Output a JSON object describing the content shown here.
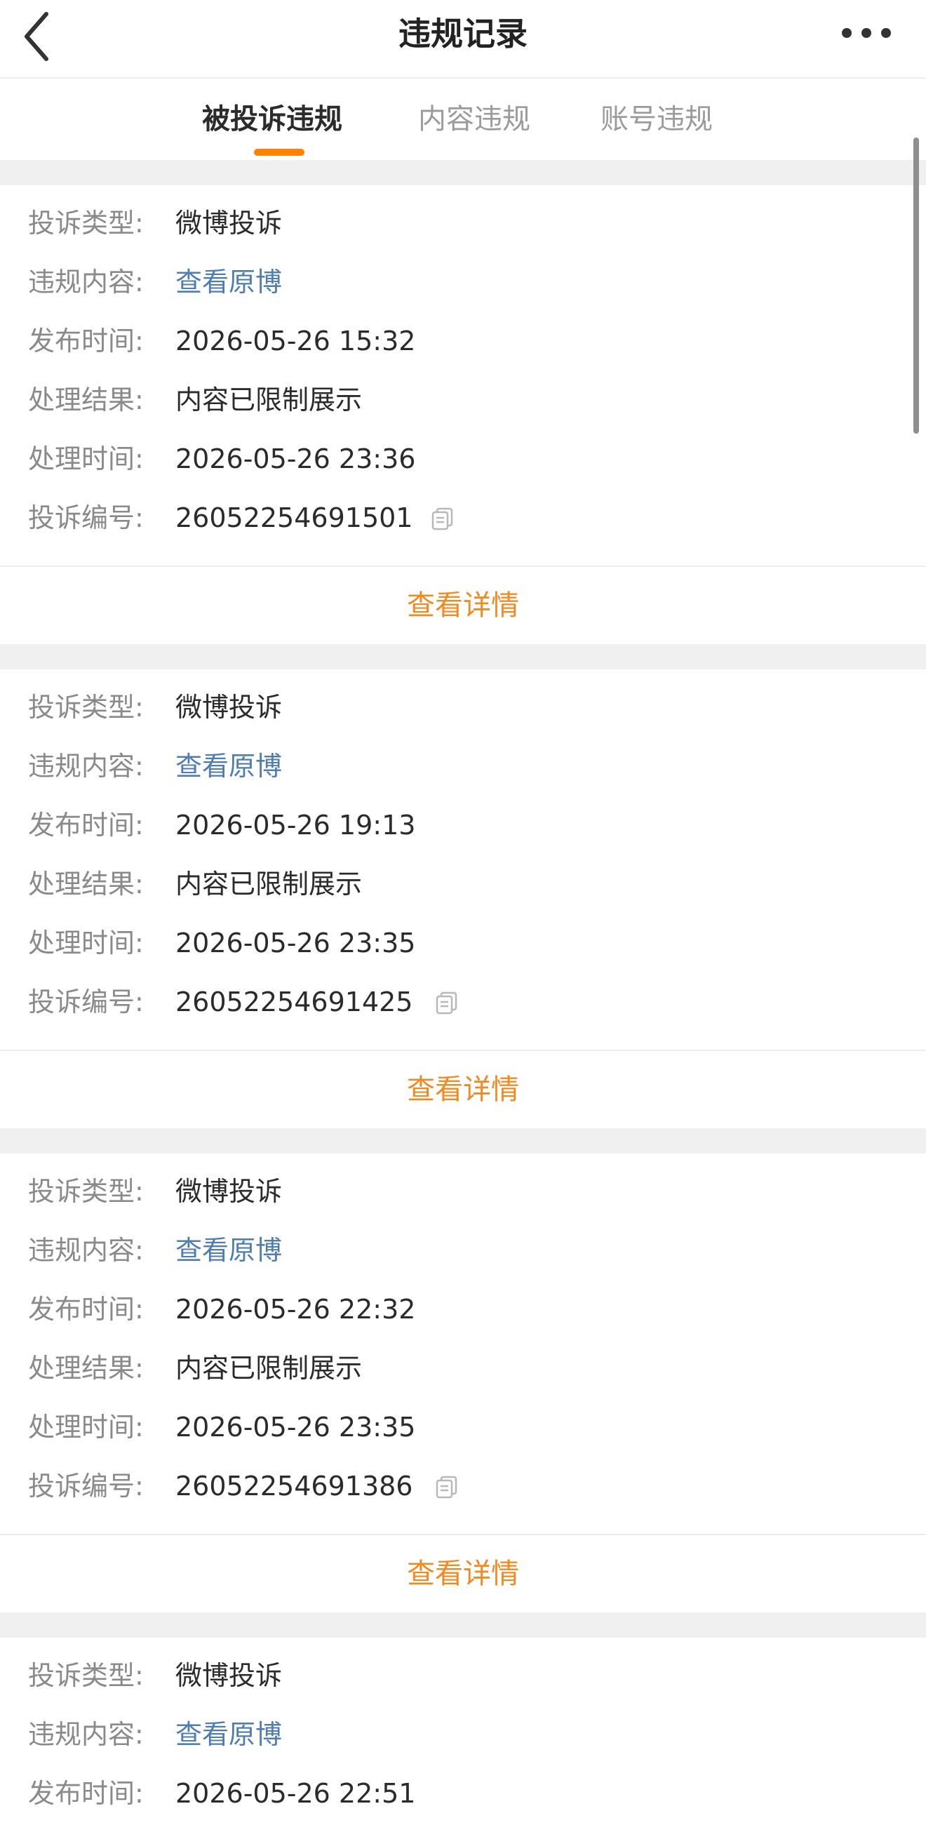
{
  "header": {
    "title": "违规记录",
    "back_icon": "chevron-left-icon",
    "more_icon": "more-horizontal-icon"
  },
  "tabs": [
    {
      "label": "被投诉违规",
      "active": true
    },
    {
      "label": "内容违规",
      "active": false
    },
    {
      "label": "账号违规",
      "active": false
    }
  ],
  "colors": {
    "accent": "#ff8200",
    "link": "#507daf",
    "detail": "#f08a22",
    "label": "#8a8a8a",
    "value": "#2b2b2b",
    "separator": "#f0f0f0"
  },
  "labels": {
    "type": "投诉类型:",
    "content": "违规内容:",
    "publish_time": "发布时间:",
    "result": "处理结果:",
    "process_time": "处理时间:",
    "number": "投诉编号:"
  },
  "records": [
    {
      "type": "微博投诉",
      "content_link": "查看原博",
      "publish_time": "2026-05-26 15:32",
      "result": "内容已限制展示",
      "process_time": "2026-05-26 23:36",
      "number": "26052254691501",
      "detail_label": "查看详情"
    },
    {
      "type": "微博投诉",
      "content_link": "查看原博",
      "publish_time": "2026-05-26 19:13",
      "result": "内容已限制展示",
      "process_time": "2026-05-26 23:35",
      "number": "26052254691425",
      "detail_label": "查看详情"
    },
    {
      "type": "微博投诉",
      "content_link": "查看原博",
      "publish_time": "2026-05-26 22:32",
      "result": "内容已限制展示",
      "process_time": "2026-05-26 23:35",
      "number": "26052254691386",
      "detail_label": "查看详情"
    },
    {
      "type": "微博投诉",
      "content_link": "查看原博",
      "publish_time": "2026-05-26 22:51"
    }
  ]
}
